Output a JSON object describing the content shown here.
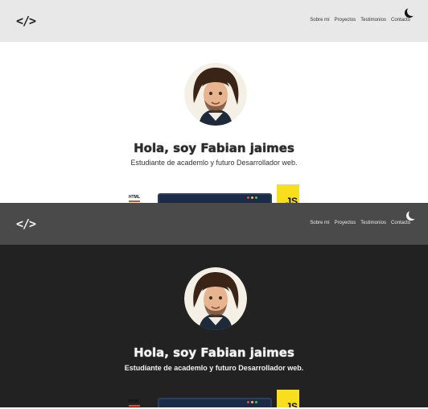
{
  "logo": "</>",
  "theme_toggle_icon": "moon-icon",
  "nav_links": [
    "Sobre mí",
    "Proyectos",
    "Testimonios",
    "Contacto"
  ],
  "hero": {
    "title": "Hola, soy Fabian jaimes",
    "subtitle": "Estudiante de academlo y futuro Desarrollador web."
  },
  "badges": {
    "html": "HTML",
    "js": "JS"
  },
  "colors": {
    "light_nav": "#e8e8e8",
    "dark_nav": "#4a4a4a",
    "dark_bg": "#222222",
    "js_yellow": "#f7df1e",
    "html_orange": "#e34c26"
  }
}
